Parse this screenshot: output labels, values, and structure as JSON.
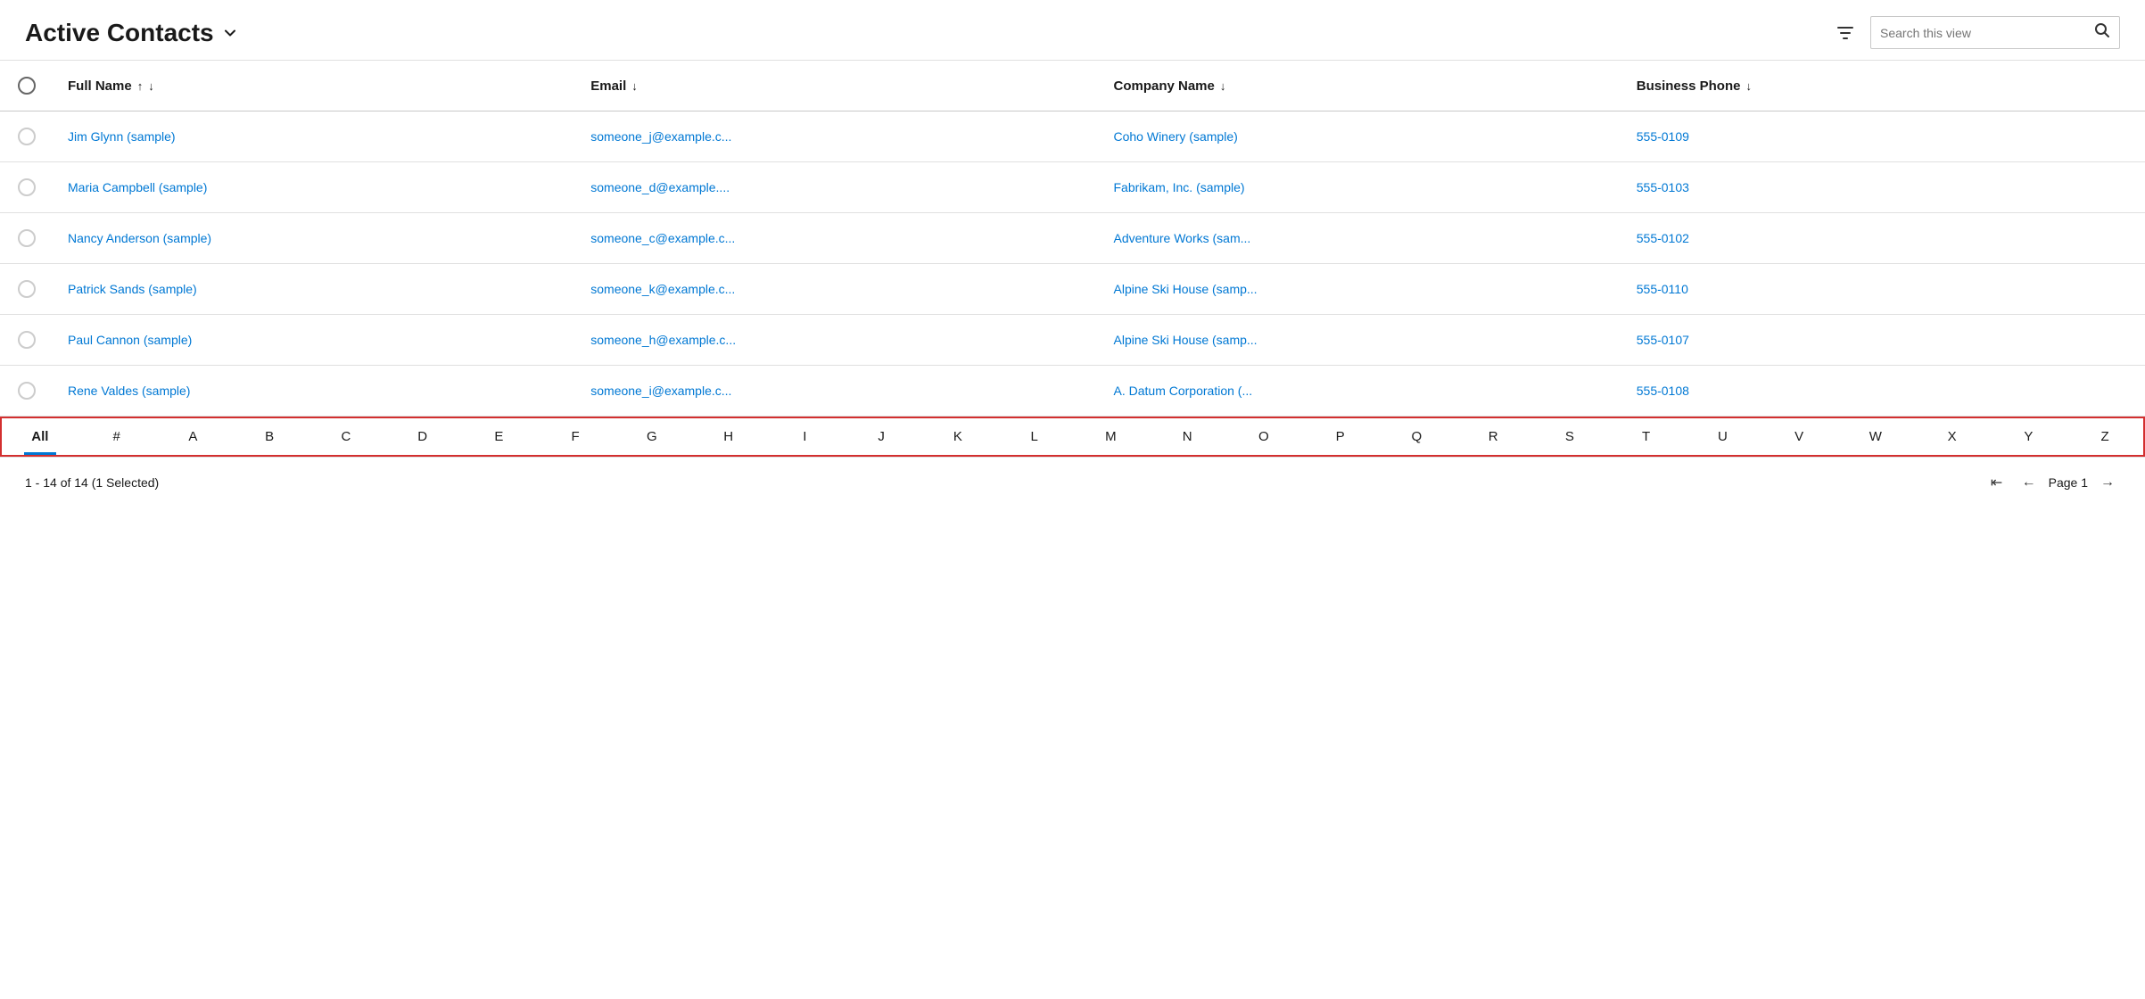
{
  "header": {
    "title": "Active Contacts",
    "chevron": "▾",
    "search_placeholder": "Search this view"
  },
  "columns": [
    {
      "key": "fullname",
      "label": "Full Name",
      "sortable": true,
      "sort_up": "↑",
      "sort_down": "↓"
    },
    {
      "key": "email",
      "label": "Email",
      "sortable": true,
      "sort_down": "↓"
    },
    {
      "key": "company",
      "label": "Company Name",
      "sortable": true,
      "sort_down": "↓"
    },
    {
      "key": "phone",
      "label": "Business Phone",
      "sortable": true,
      "sort_down": "↓"
    }
  ],
  "rows": [
    {
      "fullname": "Jim Glynn (sample)",
      "email": "someone_j@example.c...",
      "company": "Coho Winery (sample)",
      "phone": "555-0109"
    },
    {
      "fullname": "Maria Campbell (sample)",
      "email": "someone_d@example....",
      "company": "Fabrikam, Inc. (sample)",
      "phone": "555-0103"
    },
    {
      "fullname": "Nancy Anderson (sample)",
      "email": "someone_c@example.c...",
      "company": "Adventure Works (sam...",
      "phone": "555-0102"
    },
    {
      "fullname": "Patrick Sands (sample)",
      "email": "someone_k@example.c...",
      "company": "Alpine Ski House (samp...",
      "phone": "555-0110"
    },
    {
      "fullname": "Paul Cannon (sample)",
      "email": "someone_h@example.c...",
      "company": "Alpine Ski House (samp...",
      "phone": "555-0107"
    },
    {
      "fullname": "Rene Valdes (sample)",
      "email": "someone_i@example.c...",
      "company": "A. Datum Corporation (...",
      "phone": "555-0108"
    }
  ],
  "alphabet": [
    "All",
    "#",
    "A",
    "B",
    "C",
    "D",
    "E",
    "F",
    "G",
    "H",
    "I",
    "J",
    "K",
    "L",
    "M",
    "N",
    "O",
    "P",
    "Q",
    "R",
    "S",
    "T",
    "U",
    "V",
    "W",
    "X",
    "Y",
    "Z"
  ],
  "active_alpha": "All",
  "footer": {
    "status": "1 - 14 of 14 (1 Selected)",
    "page_label": "Page 1"
  }
}
